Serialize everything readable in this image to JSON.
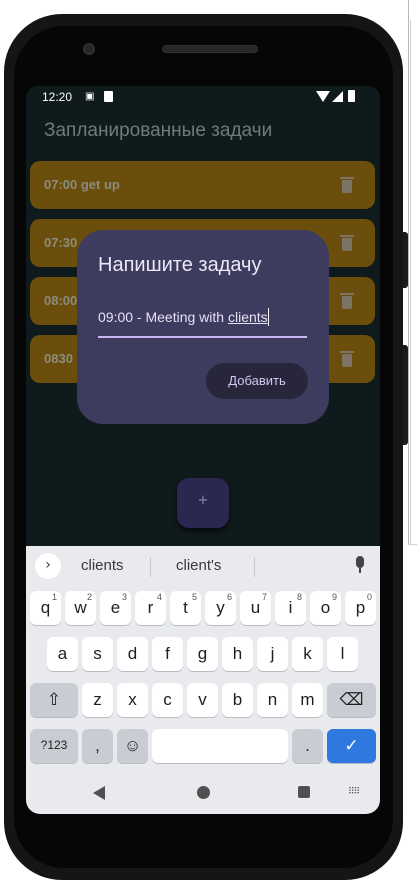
{
  "status_bar": {
    "time": "12:20",
    "sim_icon": "sim-card-icon",
    "sd_icon": "sd-card-icon"
  },
  "app": {
    "title": "Запланированные задачи",
    "tasks": [
      {
        "label": "07:00 get up"
      },
      {
        "label": "07:30"
      },
      {
        "label": "08:00"
      },
      {
        "label": "0830"
      }
    ],
    "fab_label": "+"
  },
  "dialog": {
    "title": "Напишите задачу",
    "input_prefix": "09:00 - Meeting with ",
    "input_word": "clients",
    "add_button": "Добавить"
  },
  "keyboard": {
    "suggestions": [
      "clients",
      "client's"
    ],
    "row1": [
      {
        "key": "q",
        "hint": "1"
      },
      {
        "key": "w",
        "hint": "2"
      },
      {
        "key": "e",
        "hint": "3"
      },
      {
        "key": "r",
        "hint": "4"
      },
      {
        "key": "t",
        "hint": "5"
      },
      {
        "key": "y",
        "hint": "6"
      },
      {
        "key": "u",
        "hint": "7"
      },
      {
        "key": "i",
        "hint": "8"
      },
      {
        "key": "o",
        "hint": "9"
      },
      {
        "key": "p",
        "hint": "0"
      }
    ],
    "row2": [
      "a",
      "s",
      "d",
      "f",
      "g",
      "h",
      "j",
      "k",
      "l"
    ],
    "row3": [
      "z",
      "x",
      "c",
      "v",
      "b",
      "n",
      "m"
    ],
    "symbols_key": "?123",
    "comma_key": ",",
    "period_key": "."
  },
  "colors": {
    "screen_bg": "#0f1a1c",
    "task_bg": "#6b4e0c",
    "dialog_bg": "#3d3b5e",
    "accent": "#c9b8f6",
    "enter_key": "#2f78e0"
  }
}
